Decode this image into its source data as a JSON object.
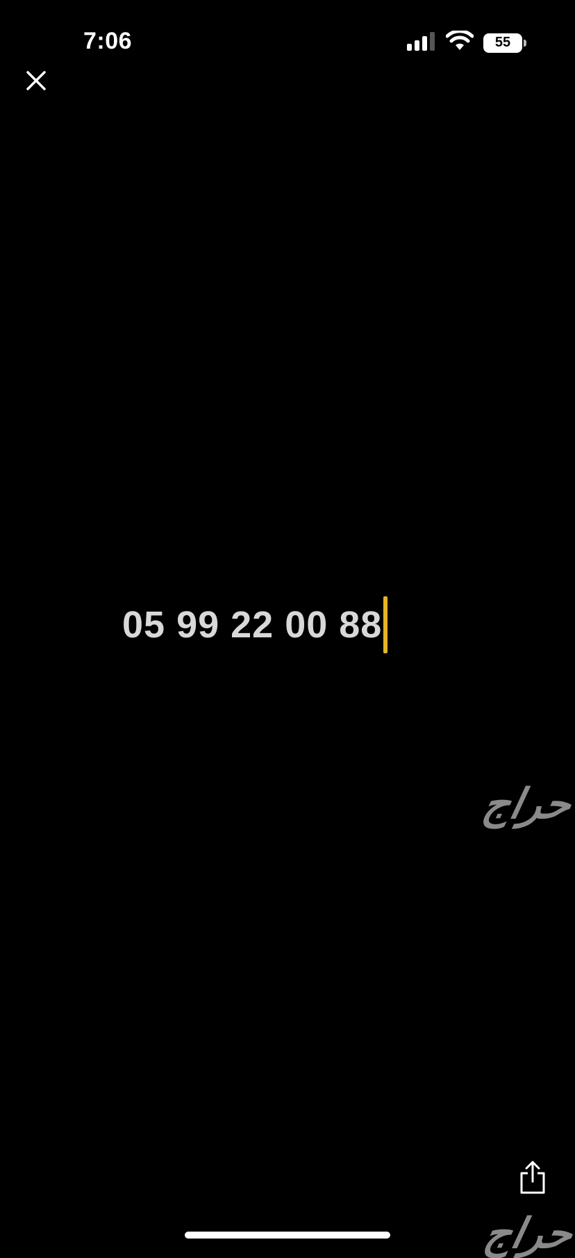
{
  "status_bar": {
    "time": "7:06",
    "battery_level": "55",
    "icons": [
      "signal-icon",
      "wifi-icon",
      "battery-icon"
    ]
  },
  "toolbar": {
    "close_icon": "close-icon",
    "share_icon": "share-icon"
  },
  "media": {
    "phone_number": "05 99 22 00 88",
    "watermark_text": "حراج",
    "cursor_color": "#e6b422"
  }
}
